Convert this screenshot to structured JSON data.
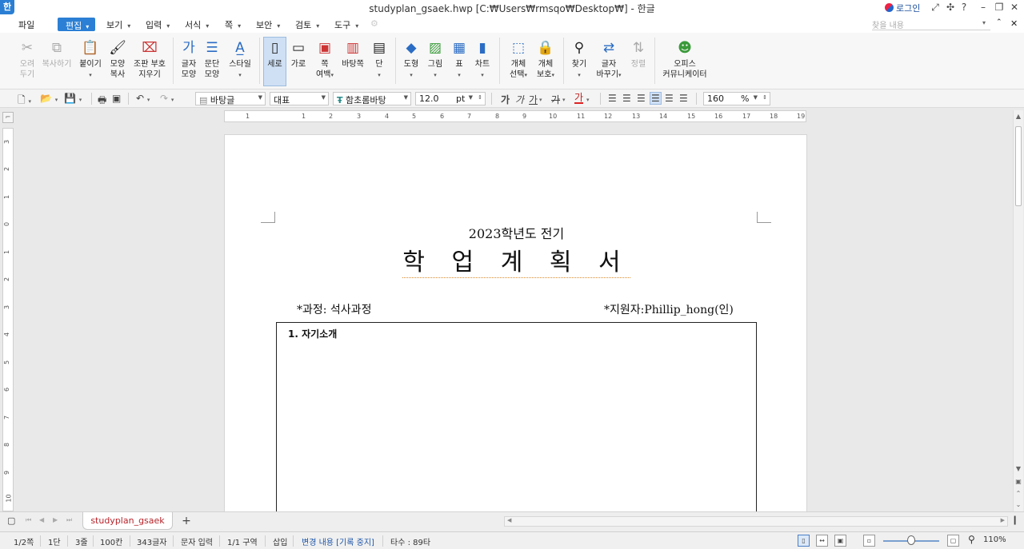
{
  "window": {
    "title": "studyplan_gsaek.hwp [C:₩Users₩rmsqo₩Desktop₩] - 한글",
    "logo_char": "한",
    "login_label": "로그인",
    "icons": [
      "fullscreen-icon",
      "pin-icon",
      "help-icon",
      "minimize-icon",
      "restore-icon",
      "close-icon"
    ]
  },
  "menubar": {
    "file": "파일",
    "items": [
      "편집",
      "보기",
      "입력",
      "서식",
      "쪽",
      "보안",
      "검토",
      "도구"
    ],
    "search_placeholder": "찾을 내용"
  },
  "ribbon": {
    "cut": [
      "오려",
      "두기"
    ],
    "copy": "복사하기",
    "paste": "붙이기",
    "format_copy": [
      "모양",
      "복사"
    ],
    "erase_marks": [
      "조판 부호",
      "지우기"
    ],
    "char_shape": [
      "글자",
      "모양"
    ],
    "para_shape": [
      "문단",
      "모양"
    ],
    "style": "스타일",
    "vertical": "세로",
    "horizontal": "가로",
    "page_margin": [
      "쪽",
      "여백"
    ],
    "background_page": "바탕쪽",
    "column": "단",
    "shape": "도형",
    "picture": "그림",
    "table": "표",
    "chart": "차트",
    "object_select": [
      "개체",
      "선택"
    ],
    "object_protect": [
      "개체",
      "보호"
    ],
    "find": "찾기",
    "replace": [
      "글자",
      "바꾸기"
    ],
    "sort": "정렬",
    "office_communicator": [
      "오피스",
      "커뮤니케이터"
    ]
  },
  "format_bar": {
    "style_value": "바탕글",
    "lang_value": "대표",
    "font_value": "함초롬바탕",
    "size_value": "12.0",
    "size_unit": "pt",
    "bold": "가",
    "italic": "가",
    "underline": "가",
    "strike": "가",
    "color": "가",
    "zoom_value": "160",
    "zoom_unit": "%"
  },
  "ruler": {
    "h_ticks": [
      "1",
      "1",
      "2",
      "3",
      "4",
      "5",
      "6",
      "7",
      "8",
      "9",
      "10",
      "11",
      "12",
      "13",
      "14",
      "15",
      "16",
      "17",
      "18",
      "19"
    ],
    "v_ticks": [
      "3",
      "2",
      "1",
      "0",
      "1",
      "2",
      "3",
      "4",
      "5",
      "6",
      "7",
      "8",
      "9",
      "10"
    ]
  },
  "document": {
    "subtitle": "2023학년도 전기",
    "title": "학 업 계 획 서",
    "course": "*과정: 석사과정",
    "applicant": "*지원자:Phillip_hong(인)",
    "section1": "1. 자기소개"
  },
  "tabs": {
    "doc_tab": "studyplan_gsaek",
    "add": "+"
  },
  "statusbar": {
    "page": "1/2쪽",
    "column": "1단",
    "line": "3줄",
    "col": "100칸",
    "chars": "343글자",
    "input_mode": "문자 입력",
    "section": "1/1 구역",
    "insert": "삽입",
    "track_changes": "변경 내용 [기록 중지]",
    "typing": "타수 : 89타",
    "zoom": "110%"
  }
}
